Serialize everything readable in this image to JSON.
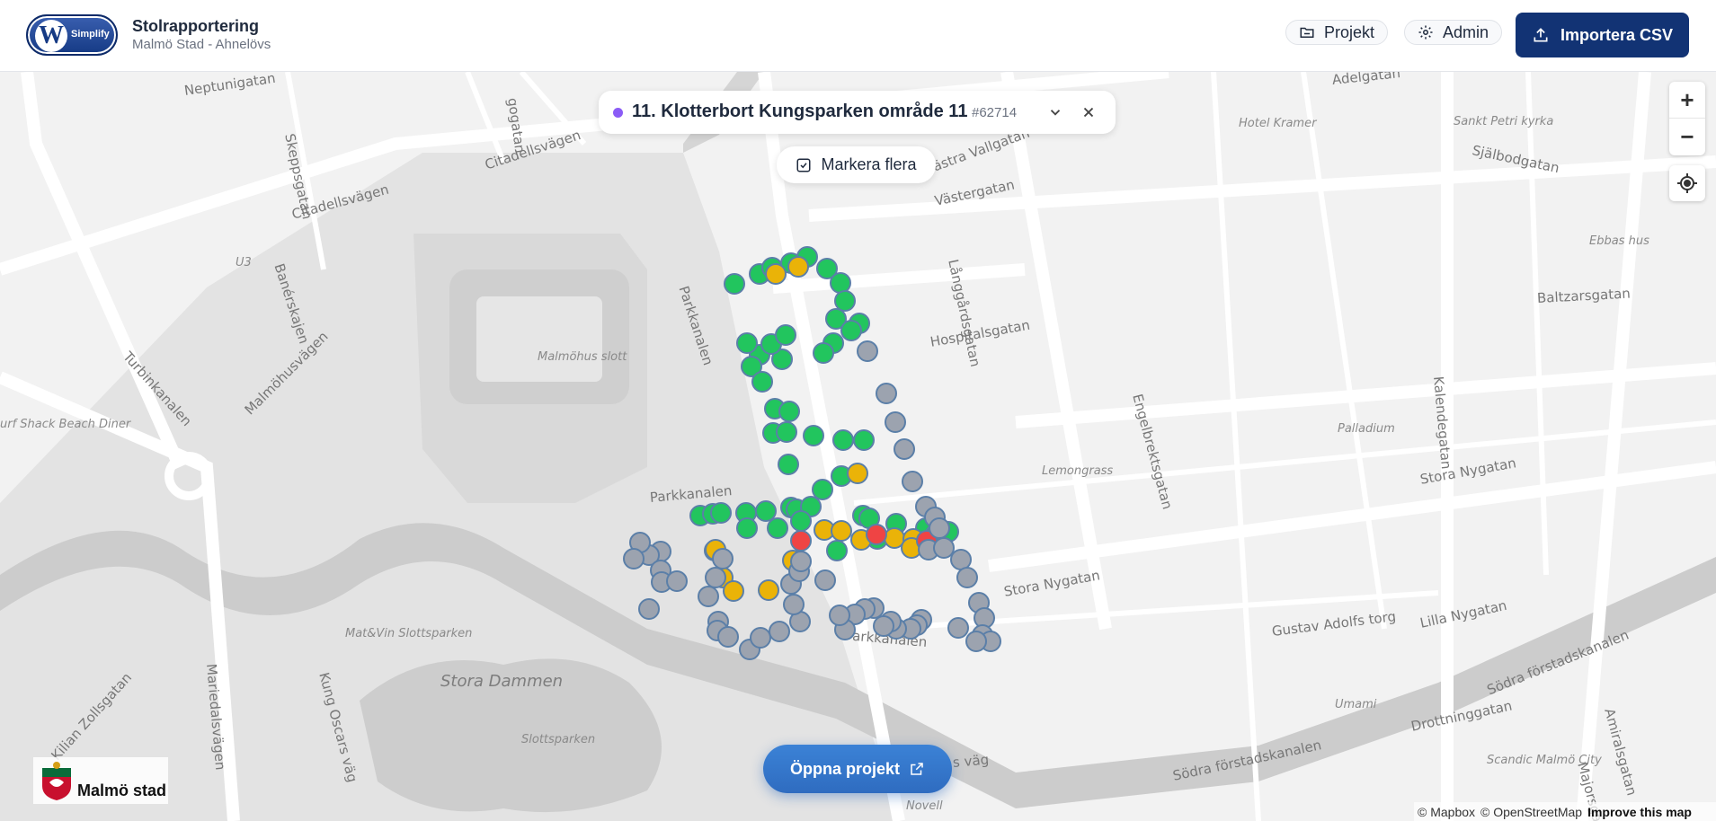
{
  "header": {
    "logo_text": "Simplify",
    "logo_letter": "W",
    "title": "Stolrapportering",
    "subtitle": "Malmö Stad - Ahnelövs",
    "projekt_label": "Projekt",
    "admin_label": "Admin",
    "import_label": "Importera CSV"
  },
  "project": {
    "name": "11. Klotterbort Kungsparken område 11",
    "id": "#62714",
    "dot_color": "#8b5cf6",
    "mark_label": "Markera flera",
    "open_label": "Öppna projekt"
  },
  "map": {
    "streets": [
      "Neptunigatan",
      "Skeppsgatan",
      "gogatan",
      "Citadellsvägen",
      "Citadellsvägen",
      "Banérskajen",
      "Malmöhusvägen",
      "Turbinkanalen",
      "Parkkanalen",
      "Västra Vallgatan",
      "Västergatan",
      "Långgårdsgatan",
      "Hospitalsgatan",
      "Engelbrektsgatan",
      "Kalendegatan",
      "Baltzarsgatan",
      "Stora Nygatan",
      "Stora Nygatan",
      "Lilla Nygatan",
      "Gustav Adolfs torg",
      "Södra förstadskanalen",
      "Drottninggatan",
      "Amiralsgatan",
      "Majorsgatan",
      "Mariedalsvägen",
      "Kung Oscars väg",
      "Kilian Zollsgatan",
      "Adelgatan",
      "Själbodgatan",
      "Parkkanalen",
      "Parkkanalen",
      "Södra förstadskanalen",
      "s väg"
    ],
    "pois": [
      "Hotel Kramer",
      "Sankt Petri kyrka",
      "Ebbas hus",
      "U3",
      "Malmöhus slott",
      "Palladium",
      "Lemongrass",
      "Umami",
      "Scandic Malmö City",
      "Mat&Vin Slottsparken",
      "Slottsparken",
      "Novell",
      "urf Shack Beach Diner"
    ],
    "big_labels": [
      "Stora Dammen"
    ],
    "marker_colors": {
      "green": "#22c55e",
      "yellow": "#eab308",
      "red": "#ef4444",
      "gray": "#9ca3af"
    }
  },
  "controls": {
    "zoom_in": "+",
    "zoom_out": "−"
  },
  "footer": {
    "city_logo": "Malmö stad",
    "attribution_mapbox": "© Mapbox",
    "attribution_osm": "© OpenStreetMap",
    "improve": "Improve this map"
  }
}
